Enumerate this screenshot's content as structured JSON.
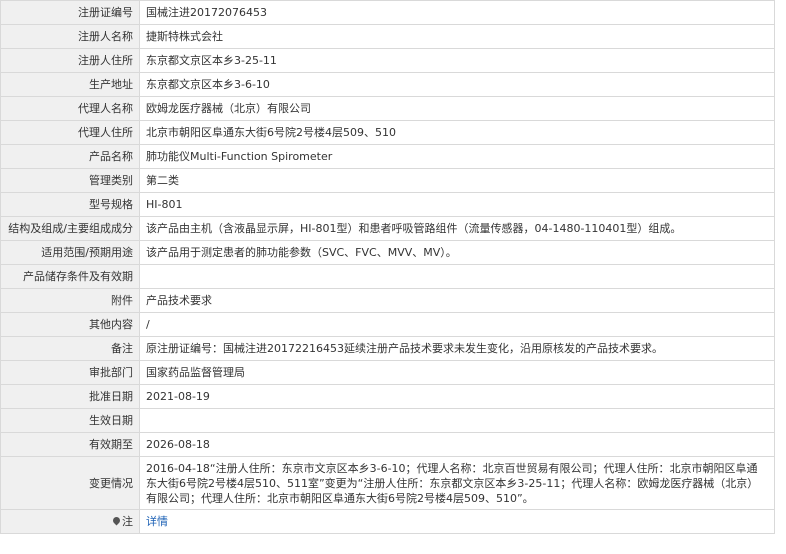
{
  "rows": [
    {
      "label": "注册证编号",
      "value": "国械注进20172076453"
    },
    {
      "label": "注册人名称",
      "value": "捷斯特株式会社"
    },
    {
      "label": "注册人住所",
      "value": "东京都文京区本乡3-25-11"
    },
    {
      "label": "生产地址",
      "value": "东京都文京区本乡3-6-10"
    },
    {
      "label": "代理人名称",
      "value": "欧姆龙医疗器械（北京）有限公司"
    },
    {
      "label": "代理人住所",
      "value": "北京市朝阳区阜通东大街6号院2号楼4层509、510"
    },
    {
      "label": "产品名称",
      "value": "肺功能仪Multi-Function Spirometer"
    },
    {
      "label": "管理类别",
      "value": "第二类"
    },
    {
      "label": "型号规格",
      "value": "HI-801"
    },
    {
      "label": "结构及组成/主要组成成分",
      "value": "该产品由主机（含液晶显示屏，HI-801型）和患者呼吸管路组件（流量传感器，04-1480-110401型）组成。"
    },
    {
      "label": "适用范围/预期用途",
      "value": "该产品用于测定患者的肺功能参数（SVC、FVC、MVV、MV）。"
    },
    {
      "label": "产品储存条件及有效期",
      "value": ""
    },
    {
      "label": "附件",
      "value": "产品技术要求"
    },
    {
      "label": "其他内容",
      "value": "/"
    },
    {
      "label": "备注",
      "value": "原注册证编号：国械注进20172216453延续注册产品技术要求未发生变化，沿用原核发的产品技术要求。"
    },
    {
      "label": "审批部门",
      "value": "国家药品监督管理局"
    },
    {
      "label": "批准日期",
      "value": "2021-08-19"
    },
    {
      "label": "生效日期",
      "value": ""
    },
    {
      "label": "有效期至",
      "value": "2026-08-18"
    }
  ],
  "change": {
    "label": "变更情况",
    "value": "2016-04-18“注册人住所：东京市文京区本乡3-6-10；代理人名称：北京百世贸易有限公司；代理人住所：北京市朝阳区阜通东大街6号院2号楼4层510、511室”变更为“注册人住所：东京都文京区本乡3-25-11；代理人名称：欧姆龙医疗器械（北京）有限公司；代理人住所：北京市朝阳区阜通东大街6号院2号楼4层509、510”。"
  },
  "note": {
    "label": "注",
    "icon": "map-pin-icon",
    "link": "详情"
  }
}
